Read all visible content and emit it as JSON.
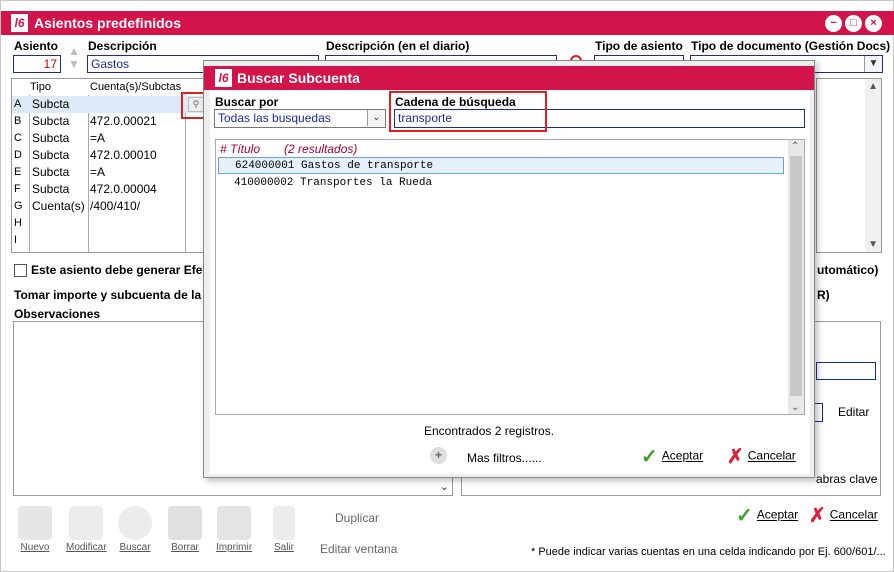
{
  "window": {
    "title": "Asientos predefinidos",
    "logo": "l6"
  },
  "header": {
    "asiento_label": "Asiento",
    "asiento_value": "17",
    "descripcion_label": "Descripción",
    "descripcion_value": "Gastos",
    "desc_diario_label": "Descripción (en el diario)",
    "tipo_asiento_label": "Tipo de asiento",
    "tipo_doc_label": "Tipo de documento (Gestión Docs)"
  },
  "grid": {
    "headers": {
      "tipo": "Tipo",
      "cuentas": "Cuenta(s)/Subctas"
    },
    "rows": [
      {
        "letter": "A",
        "tipo": "Subcta",
        "cuenta": ""
      },
      {
        "letter": "B",
        "tipo": "Subcta",
        "cuenta": "472.0.00021"
      },
      {
        "letter": "C",
        "tipo": "Subcta",
        "cuenta": "=A"
      },
      {
        "letter": "D",
        "tipo": "Subcta",
        "cuenta": "472.0.00010"
      },
      {
        "letter": "E",
        "tipo": "Subcta",
        "cuenta": "=A"
      },
      {
        "letter": "F",
        "tipo": "Subcta",
        "cuenta": "472.0.00004"
      },
      {
        "letter": "G",
        "tipo": "Cuenta(s)",
        "cuenta": "/400/410/"
      },
      {
        "letter": "H",
        "tipo": "",
        "cuenta": ""
      },
      {
        "letter": "I",
        "tipo": "",
        "cuenta": ""
      }
    ]
  },
  "efectos": {
    "label": "Este asiento debe generar Efec",
    "right_label": "utomático)"
  },
  "tomar": {
    "label": "Tomar importe y subcuenta de la f",
    "right_label": "R)"
  },
  "observaciones": {
    "label": "Observaciones"
  },
  "right_side": {
    "editar": "Editar",
    "palabras": "abras clave"
  },
  "toolbar": {
    "nuevo": "Nuevo",
    "modificar": "Modificar",
    "buscar": "Buscar",
    "borrar": "Borrar",
    "imprimir": "Imprimir",
    "salir": "Salir",
    "duplicar": "Duplicar",
    "editar_ventana": "Editar ventana"
  },
  "footer": {
    "aceptar": "Aceptar",
    "cancelar": "Cancelar",
    "note": "* Puede indicar varias cuentas en una celda indicando por Ej. 600/601/..."
  },
  "dialog": {
    "title": "Buscar Subcuenta",
    "buscar_por_label": "Buscar por",
    "buscar_por_value": "Todas las busquedas",
    "cadena_label": "Cadena de búsqueda",
    "cadena_value": "transporte",
    "results_header": "# Título",
    "results_count": "(2 resultados)",
    "results": [
      {
        "code": "624000001",
        "name": "Gastos de transporte"
      },
      {
        "code": "410000002",
        "name": "Transportes la Rueda"
      }
    ],
    "found": "Encontrados 2 registros.",
    "mas_filtros": "Mas filtros......",
    "aceptar": "Aceptar",
    "cancelar": "Cancelar"
  },
  "colors": {
    "accent": "#d2144a",
    "input_border": "#1a2aa0",
    "highlight": "#e02020"
  }
}
